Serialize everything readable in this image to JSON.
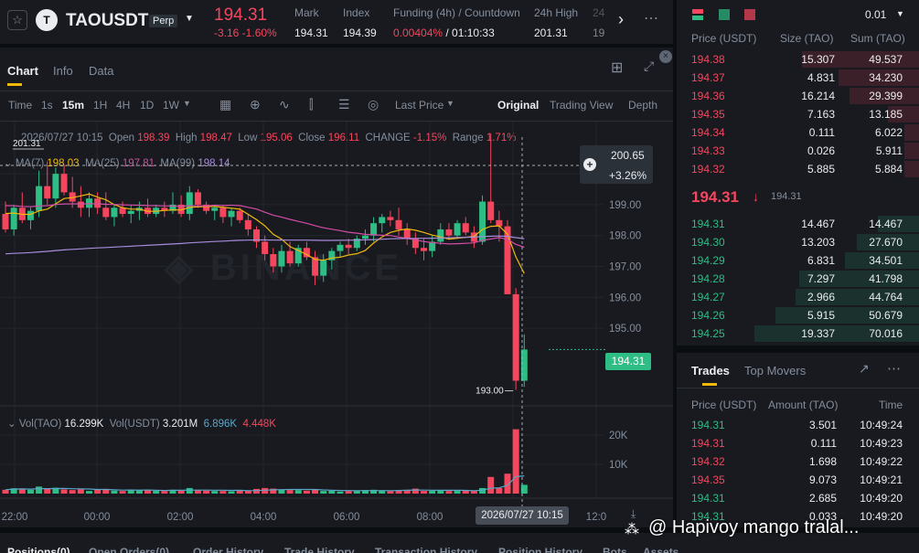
{
  "header": {
    "symbol": "TAOUSDT",
    "contract_badge": "Perp",
    "last_price": "194.31",
    "change": "-3.16 -1.60%",
    "stats": [
      {
        "label": "Mark",
        "value": "194.31"
      },
      {
        "label": "Index",
        "value": "194.39"
      },
      {
        "label": "Funding (4h) / Countdown",
        "value": "0.00404%",
        "value2": "/ 01:10:33"
      },
      {
        "label": "24h High",
        "value": "201.31"
      },
      {
        "label": "24",
        "value": "19"
      }
    ]
  },
  "chart_tabs": [
    "Chart",
    "Info",
    "Data"
  ],
  "toolbar": {
    "time_label": "Time",
    "intervals": [
      "1s",
      "15m",
      "1H",
      "4H",
      "1D",
      "1W"
    ],
    "active_interval": "15m",
    "price_type": "Last Price",
    "views": [
      "Original",
      "Trading View",
      "Depth"
    ],
    "active_view": "Original"
  },
  "ohlc": {
    "datetime": "2026/07/27 10:15",
    "open_label": "Open",
    "open": "198.39",
    "high_label": "High",
    "high": "198.47",
    "low_label": "Low",
    "low": "195.06",
    "close_label": "Close",
    "close": "196.11",
    "change_label": "CHANGE",
    "change": "-1.15%",
    "range_label": "Range",
    "range": "1.71%"
  },
  "ma": {
    "ma7_label": "MA(7)",
    "ma7": "198.03",
    "ma25_label": "MA(25)",
    "ma25": "197.81",
    "ma99_label": "MA(99)",
    "ma99": "198.14"
  },
  "volume_legend": {
    "vol_tao_label": "Vol(TAO)",
    "vol_tao": "16.299K",
    "vol_usdt_label": "Vol(USDT)",
    "vol_usdt": "3.201M",
    "v1": "6.896K",
    "v2": "4.448K"
  },
  "crosshair": {
    "price": "200.65",
    "pct": "+3.26%",
    "time": "2026/07/27 10:15"
  },
  "marks": {
    "high": "201.31",
    "low": "193.00"
  },
  "current_price_tag": "194.31",
  "chart_data": {
    "type": "candlestick",
    "interval": "15m",
    "y_axis_ticks": [
      195,
      196,
      197,
      198,
      199,
      200
    ],
    "ylim": [
      193.7,
      200.3
    ],
    "x_tick_labels": [
      "22:00",
      "00:00",
      "02:00",
      "04:00",
      "06:00",
      "08:00",
      "10:15",
      "12:0"
    ],
    "volume_ticks": [
      "10K",
      "20K"
    ],
    "volume_ylim": [
      0,
      30000
    ],
    "candles": [
      [
        198.7,
        199.1,
        198.1,
        198.2
      ],
      [
        198.2,
        199.0,
        198.0,
        198.9
      ],
      [
        198.9,
        199.4,
        198.4,
        198.5
      ],
      [
        198.5,
        198.9,
        198.2,
        198.8
      ],
      [
        198.8,
        200.1,
        198.6,
        199.6
      ],
      [
        199.6,
        200.4,
        199.0,
        199.2
      ],
      [
        199.2,
        200.2,
        198.9,
        200.0
      ],
      [
        200.0,
        200.3,
        199.3,
        199.4
      ],
      [
        199.4,
        199.9,
        198.9,
        199.1
      ],
      [
        199.1,
        199.6,
        198.6,
        198.9
      ],
      [
        198.9,
        199.4,
        198.6,
        199.2
      ],
      [
        199.2,
        199.4,
        198.7,
        198.9
      ],
      [
        198.9,
        199.4,
        198.5,
        198.6
      ],
      [
        198.6,
        199.0,
        198.3,
        198.9
      ],
      [
        198.9,
        199.1,
        198.6,
        198.7
      ],
      [
        198.7,
        199.0,
        198.4,
        198.8
      ],
      [
        198.8,
        199.1,
        198.5,
        198.9
      ],
      [
        198.9,
        199.2,
        198.6,
        198.7
      ],
      [
        198.7,
        199.0,
        198.6,
        198.9
      ],
      [
        198.9,
        199.1,
        198.6,
        198.8
      ],
      [
        198.8,
        199.4,
        198.7,
        199.0
      ],
      [
        199.0,
        199.3,
        198.6,
        198.7
      ],
      [
        198.7,
        199.6,
        198.5,
        199.4
      ],
      [
        199.4,
        199.5,
        198.9,
        199.0
      ],
      [
        199.0,
        199.1,
        198.7,
        198.8
      ],
      [
        198.8,
        199.0,
        198.5,
        198.9
      ],
      [
        198.9,
        199.0,
        198.4,
        198.6
      ],
      [
        198.6,
        198.9,
        198.3,
        198.8
      ],
      [
        198.8,
        198.9,
        198.4,
        198.5
      ],
      [
        198.5,
        198.7,
        198.0,
        198.2
      ],
      [
        198.2,
        198.3,
        197.6,
        197.8
      ],
      [
        197.8,
        198.0,
        197.2,
        197.4
      ],
      [
        197.4,
        197.6,
        196.8,
        197.0
      ],
      [
        197.0,
        197.7,
        196.8,
        197.5
      ],
      [
        197.5,
        197.8,
        197.0,
        197.1
      ],
      [
        197.1,
        197.7,
        197.0,
        197.6
      ],
      [
        197.6,
        197.8,
        197.2,
        197.3
      ],
      [
        197.3,
        197.5,
        196.4,
        196.7
      ],
      [
        196.7,
        197.4,
        196.5,
        197.2
      ],
      [
        197.2,
        197.6,
        196.9,
        197.5
      ],
      [
        197.5,
        197.8,
        197.3,
        197.7
      ],
      [
        197.7,
        197.9,
        197.4,
        197.6
      ],
      [
        197.6,
        198.0,
        197.5,
        197.9
      ],
      [
        197.9,
        198.2,
        197.7,
        198.0
      ],
      [
        198.0,
        198.6,
        197.8,
        198.4
      ],
      [
        198.4,
        198.7,
        198.1,
        198.6
      ],
      [
        198.6,
        198.8,
        198.3,
        198.5
      ],
      [
        198.5,
        198.9,
        198.0,
        198.2
      ],
      [
        198.2,
        198.4,
        197.7,
        197.9
      ],
      [
        197.9,
        198.1,
        197.4,
        197.6
      ],
      [
        197.6,
        197.9,
        197.2,
        197.5
      ],
      [
        197.5,
        198.0,
        197.3,
        197.8
      ],
      [
        197.8,
        198.4,
        197.7,
        198.2
      ],
      [
        198.2,
        198.4,
        197.9,
        198.0
      ],
      [
        198.0,
        198.5,
        197.9,
        198.4
      ],
      [
        198.4,
        198.6,
        198.0,
        198.1
      ],
      [
        198.1,
        198.3,
        197.6,
        197.8
      ],
      [
        197.8,
        199.3,
        197.7,
        199.1
      ],
      [
        199.1,
        201.31,
        198.4,
        198.5
      ],
      [
        198.5,
        198.8,
        197.8,
        198.3
      ],
      [
        198.3,
        198.5,
        197.2,
        196.1
      ],
      [
        196.1,
        196.3,
        193.0,
        193.3
      ],
      [
        193.3,
        194.8,
        193.1,
        194.31
      ]
    ],
    "volumes": [
      1300,
      1800,
      1700,
      1300,
      2400,
      1600,
      2000,
      1400,
      1200,
      1500,
      900,
      1300,
      1600,
      1000,
      900,
      1400,
      1200,
      1100,
      1000,
      900,
      1300,
      1000,
      1900,
      1200,
      1000,
      900,
      900,
      800,
      1100,
      1000,
      1600,
      1900,
      1700,
      1300,
      1200,
      1200,
      1000,
      1500,
      900,
      1000,
      700,
      900,
      1000,
      1200,
      1300,
      1100,
      900,
      1100,
      1300,
      1700,
      900,
      1000,
      1000,
      900,
      1200,
      1000,
      1100,
      1900,
      5700,
      1900,
      6800,
      22000,
      3000
    ]
  },
  "orderbook": {
    "precision": "0.01",
    "headers": [
      "Price (USDT)",
      "Size (TAO)",
      "Sum (TAO)"
    ],
    "asks": [
      {
        "price": "194.38",
        "size": "15.307",
        "sum": "49.537",
        "depth": 0.71
      },
      {
        "price": "194.37",
        "size": "4.831",
        "sum": "34.230",
        "depth": 0.49
      },
      {
        "price": "194.36",
        "size": "16.214",
        "sum": "29.399",
        "depth": 0.42
      },
      {
        "price": "194.35",
        "size": "7.163",
        "sum": "13.185",
        "depth": 0.19
      },
      {
        "price": "194.34",
        "size": "0.111",
        "sum": "6.022",
        "depth": 0.09
      },
      {
        "price": "194.33",
        "size": "0.026",
        "sum": "5.911",
        "depth": 0.09
      },
      {
        "price": "194.32",
        "size": "5.885",
        "sum": "5.884",
        "depth": 0.09
      }
    ],
    "last_price": "194.31",
    "mark_price": "194.31",
    "bids": [
      {
        "price": "194.31",
        "size": "14.467",
        "sum": "14.467",
        "depth": 0.25
      },
      {
        "price": "194.30",
        "size": "13.203",
        "sum": "27.670",
        "depth": 0.38
      },
      {
        "price": "194.29",
        "size": "6.831",
        "sum": "34.501",
        "depth": 0.45
      },
      {
        "price": "194.28",
        "size": "7.297",
        "sum": "41.798",
        "depth": 0.73
      },
      {
        "price": "194.27",
        "size": "2.966",
        "sum": "44.764",
        "depth": 0.75
      },
      {
        "price": "194.26",
        "size": "5.915",
        "sum": "50.679",
        "depth": 0.87
      },
      {
        "price": "194.25",
        "size": "19.337",
        "sum": "70.016",
        "depth": 1.0
      }
    ]
  },
  "trades": {
    "tabs": [
      "Trades",
      "Top Movers"
    ],
    "headers": [
      "Price (USDT)",
      "Amount (TAO)",
      "Time"
    ],
    "rows": [
      {
        "price": "194.31",
        "amount": "3.501",
        "time": "10:49:24",
        "side": "buy"
      },
      {
        "price": "194.31",
        "amount": "0.111",
        "time": "10:49:23",
        "side": "sell"
      },
      {
        "price": "194.32",
        "amount": "1.698",
        "time": "10:49:22",
        "side": "sell"
      },
      {
        "price": "194.35",
        "amount": "9.073",
        "time": "10:49:21",
        "side": "sell"
      },
      {
        "price": "194.31",
        "amount": "2.685",
        "time": "10:49:20",
        "side": "buy"
      },
      {
        "price": "194.31",
        "amount": "0.033",
        "time": "10:49:20",
        "side": "buy"
      }
    ]
  },
  "bottom_tabs": [
    "Positions(0)",
    "Open Orders(0)",
    "Order History",
    "Trade History",
    "Transaction History",
    "Position History",
    "Bots",
    "Assets"
  ],
  "watermark": "@ Hapivoy mango tralal..."
}
